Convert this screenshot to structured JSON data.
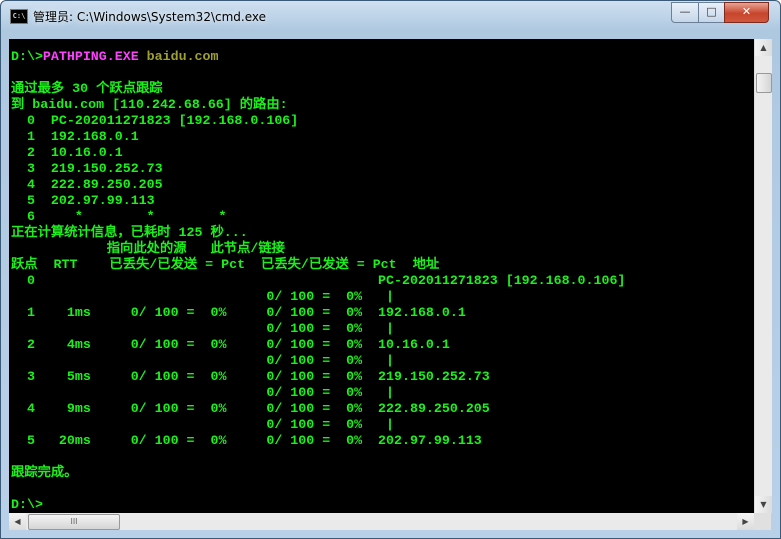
{
  "window": {
    "title": "管理员: C:\\Windows\\System32\\cmd.exe",
    "icon_label": "C:\\",
    "minimize": "—",
    "maximize": "□",
    "close": "✕"
  },
  "colors": {
    "text": "#1bf01b",
    "command": "#ff40ff",
    "argument": "#a0a030",
    "background": "#000000"
  },
  "console": {
    "prompt": "D:\\>",
    "command": "PATHPING.EXE",
    "argument": " baidu.com",
    "lines": [
      "",
      "通过最多 30 个跃点跟踪",
      "到 baidu.com [110.242.68.66] 的路由:",
      "  0  PC-202011271823 [192.168.0.106]",
      "  1  192.168.0.1",
      "  2  10.16.0.1",
      "  3  219.150.252.73",
      "  4  222.89.250.205",
      "  5  202.97.99.113",
      "  6     *        *        *",
      "正在计算统计信息，已耗时 125 秒...",
      "            指向此处的源   此节点/链接",
      "跃点  RTT    已丢失/已发送 = Pct  已丢失/已发送 = Pct  地址",
      "  0                                           PC-202011271823 [192.168.0.106]",
      "                                0/ 100 =  0%   |",
      "  1    1ms     0/ 100 =  0%     0/ 100 =  0%  192.168.0.1",
      "                                0/ 100 =  0%   |",
      "  2    4ms     0/ 100 =  0%     0/ 100 =  0%  10.16.0.1",
      "                                0/ 100 =  0%   |",
      "  3    5ms     0/ 100 =  0%     0/ 100 =  0%  219.150.252.73",
      "                                0/ 100 =  0%   |",
      "  4    9ms     0/ 100 =  0%     0/ 100 =  0%  222.89.250.205",
      "                                0/ 100 =  0%   |",
      "  5   20ms     0/ 100 =  0%     0/ 100 =  0%  202.97.99.113",
      "",
      "跟踪完成。",
      "",
      "D:\\>"
    ]
  },
  "scrollbars": {
    "up": "▲",
    "down": "▼",
    "left": "◀",
    "right": "▶",
    "grip": "III"
  }
}
